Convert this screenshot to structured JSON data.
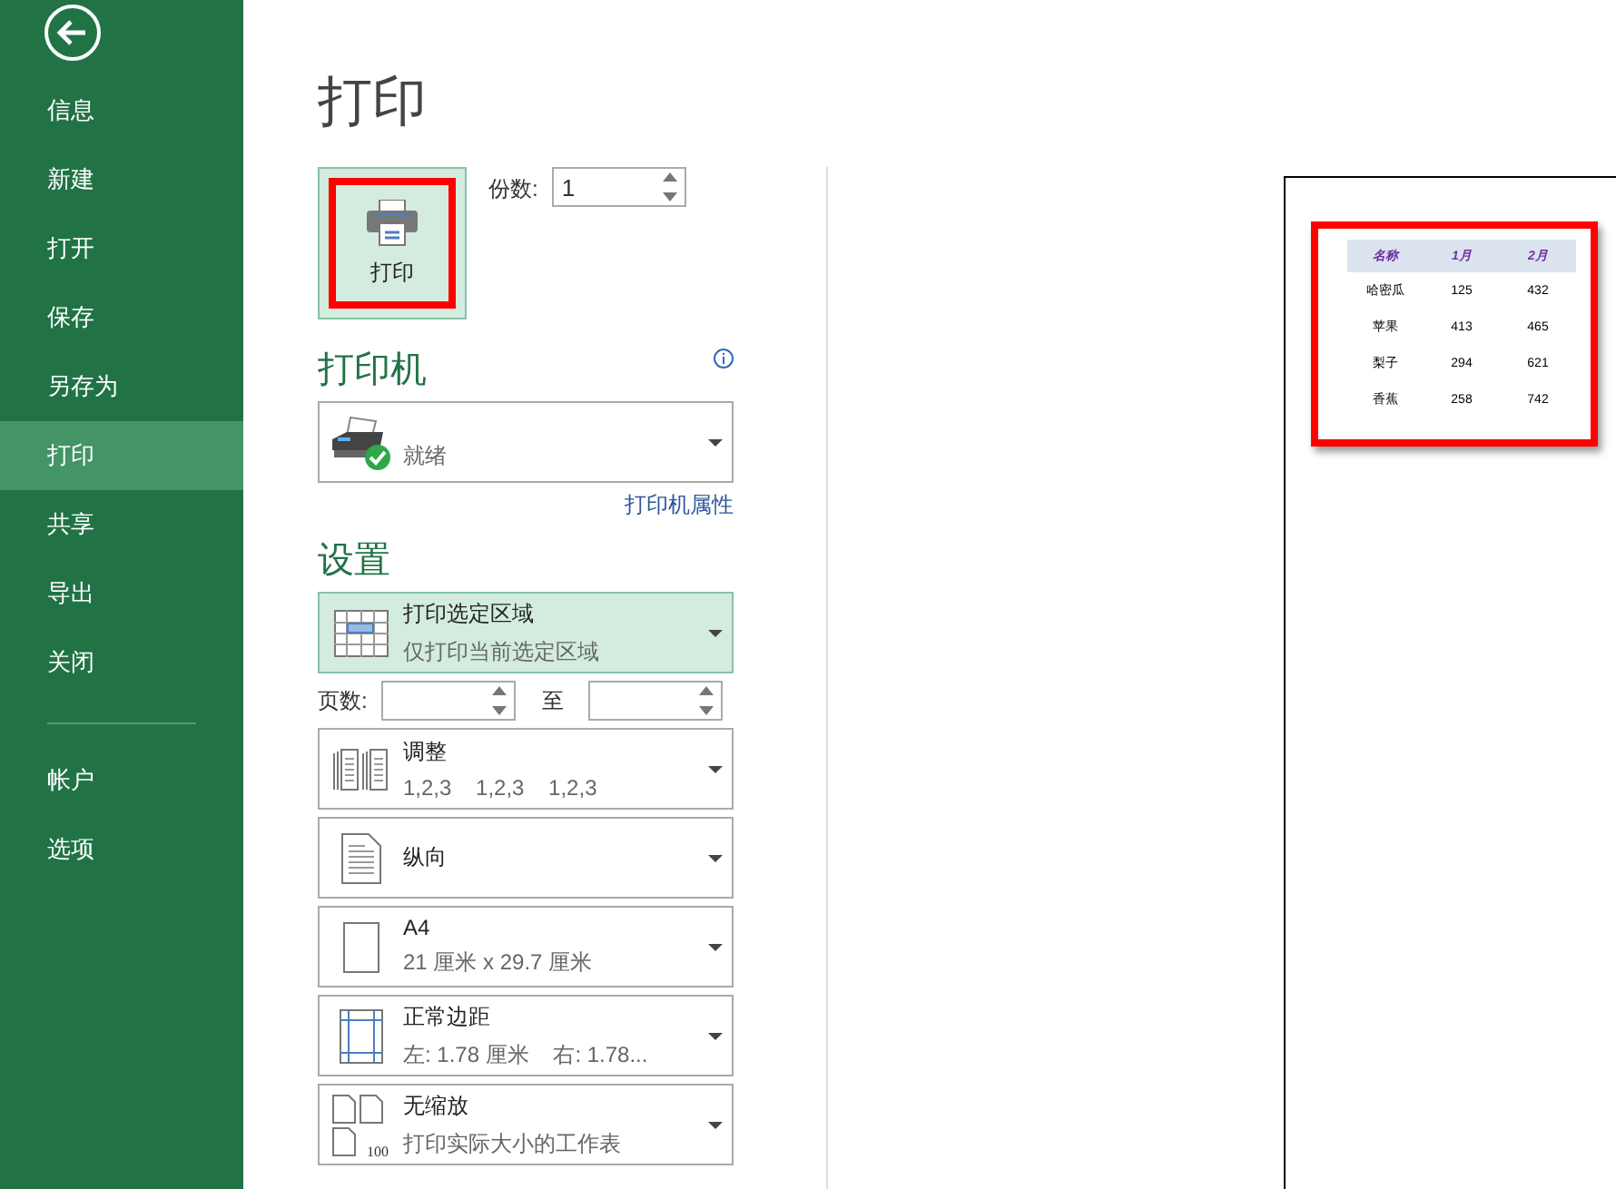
{
  "sidebar": {
    "items": [
      {
        "label": "信息",
        "selected": false
      },
      {
        "label": "新建",
        "selected": false
      },
      {
        "label": "打开",
        "selected": false
      },
      {
        "label": "保存",
        "selected": false
      },
      {
        "label": "另存为",
        "selected": false
      },
      {
        "label": "打印",
        "selected": true
      },
      {
        "label": "共享",
        "selected": false
      },
      {
        "label": "导出",
        "selected": false
      },
      {
        "label": "关闭",
        "selected": false
      }
    ],
    "bottom_items": [
      {
        "label": "帐户",
        "selected": false
      },
      {
        "label": "选项",
        "selected": false
      }
    ]
  },
  "title": "打印",
  "print_button": {
    "label": "打印",
    "highlighted": true
  },
  "copies": {
    "label": "份数:",
    "value": "1"
  },
  "printer": {
    "heading": "打印机",
    "status": "就绪",
    "properties_link": "打印机属性"
  },
  "settings": {
    "heading": "设置",
    "pages": {
      "label": "页数:",
      "to_label": "至"
    },
    "options": [
      {
        "title": "打印选定区域",
        "subtitle": "仅打印当前选定区域",
        "selected": true
      },
      {
        "title": "调整",
        "subtitle": "1,2,3    1,2,3    1,2,3",
        "selected": false
      },
      {
        "title": "纵向",
        "selected": false
      },
      {
        "title": "A4",
        "subtitle": "21 厘米 x 29.7 厘米",
        "selected": false
      },
      {
        "title": "正常边距",
        "subtitle": "左: 1.78 厘米    右: 1.78...",
        "selected": false
      },
      {
        "title": "无缩放",
        "subtitle": "打印实际大小的工作表",
        "icon_label": "100",
        "selected": false
      }
    ]
  },
  "preview": {
    "highlighted": true,
    "columns": [
      "名称",
      "1月",
      "2月"
    ],
    "rows": [
      [
        "哈密瓜",
        "125",
        "432"
      ],
      [
        "苹果",
        "413",
        "465"
      ],
      [
        "梨子",
        "294",
        "621"
      ],
      [
        "香蕉",
        "258",
        "742"
      ]
    ]
  }
}
